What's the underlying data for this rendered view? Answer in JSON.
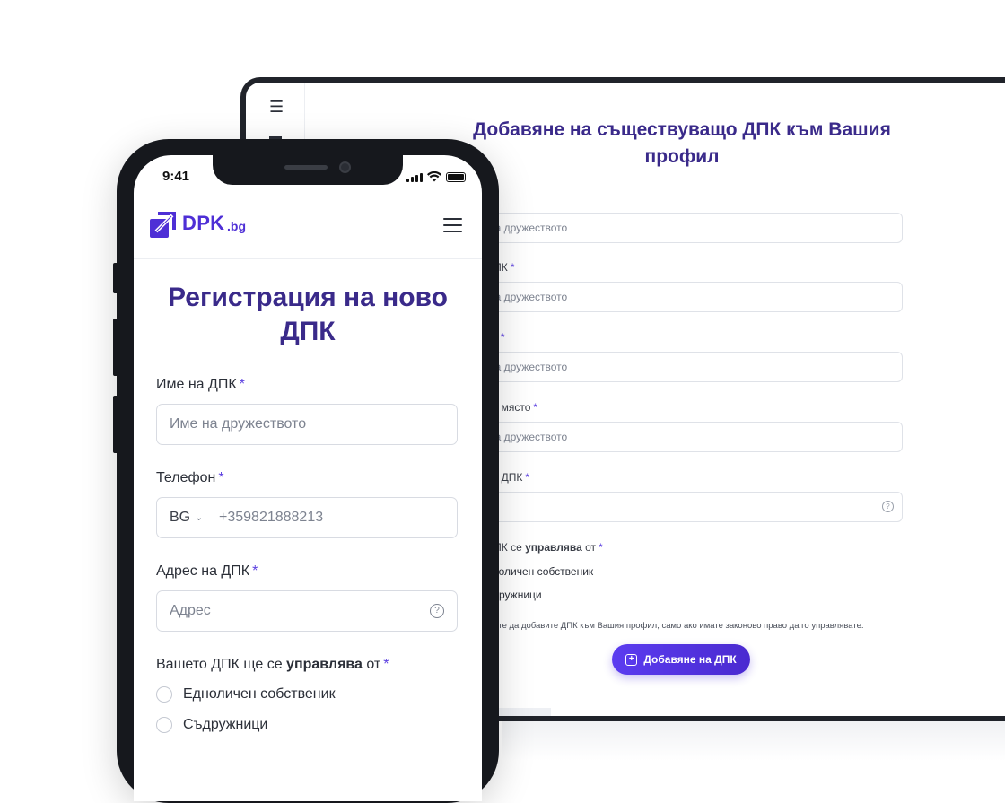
{
  "laptop": {
    "title": "Добавяне на съществуващо ДПК към Вашия профил",
    "menu_icon": "hamburger-icon",
    "fields": [
      {
        "label": "",
        "placeholder": "на дружеството"
      },
      {
        "label": "ДПК",
        "placeholder": "на дружеството"
      },
      {
        "label": "ва",
        "placeholder": "на дружеството"
      },
      {
        "label": "но място",
        "placeholder": "на дружеството"
      },
      {
        "label": "на ДПК",
        "placeholder": "с"
      }
    ],
    "manage_label_prefix": "ДПК се ",
    "manage_label_bold": "управлява",
    "manage_label_suffix": " от",
    "radios": [
      "ноличен собственик",
      "дружници"
    ],
    "note": "жете да добавите ДПК към Вашия профил, само ако имате законово право да го управлявате.",
    "button_label": "Добавяне на ДПК",
    "button_icon": "plus-square-icon"
  },
  "phone": {
    "time": "9:41",
    "logo_text": "DPK",
    "logo_tld": ".bg",
    "title": "Регистрация на ново ДПК",
    "name_label": "Име на ДПК",
    "name_placeholder": "Име на дружеството",
    "phone_label": "Телефон",
    "country_code": "BG",
    "phone_placeholder": "+359821888213",
    "address_label": "Адрес на ДПК",
    "address_placeholder": "Адрес",
    "manage_prefix": "Вашето ДПК ще се ",
    "manage_bold": "управлява",
    "manage_suffix": " от",
    "radios": [
      "Едноличен собственик",
      "Съдружници"
    ],
    "required_mark": "*"
  },
  "colors": {
    "brand": "#4e2fd6",
    "title": "#3a2a8a",
    "button": "#5b3cf0"
  }
}
